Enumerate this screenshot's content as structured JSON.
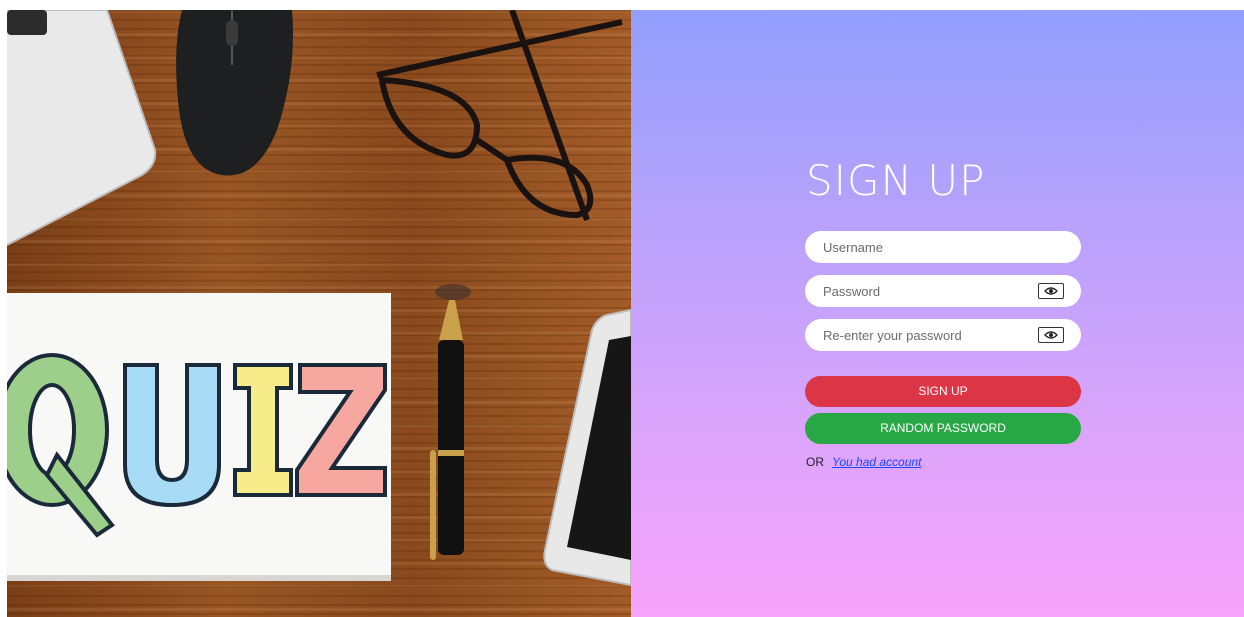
{
  "photo": {
    "quiz_letters": [
      "Q",
      "U",
      "I",
      "Z"
    ],
    "quiz_colors": [
      "#9ccf8a",
      "#a8dcf6",
      "#f7ec8a",
      "#f5a7a0"
    ]
  },
  "signup": {
    "title": "SIGN UP",
    "username_placeholder": "Username",
    "password_placeholder": "Password",
    "reenter_placeholder": "Re-enter your password",
    "signup_label": "SIGN UP",
    "random_label": "RANDOM PASSWORD",
    "or_text": "OR",
    "account_link": "You had account",
    "eye_icon": "eye-icon",
    "colors": {
      "signup": "#dc3545",
      "random": "#28a745",
      "link": "#1a4bff"
    }
  }
}
